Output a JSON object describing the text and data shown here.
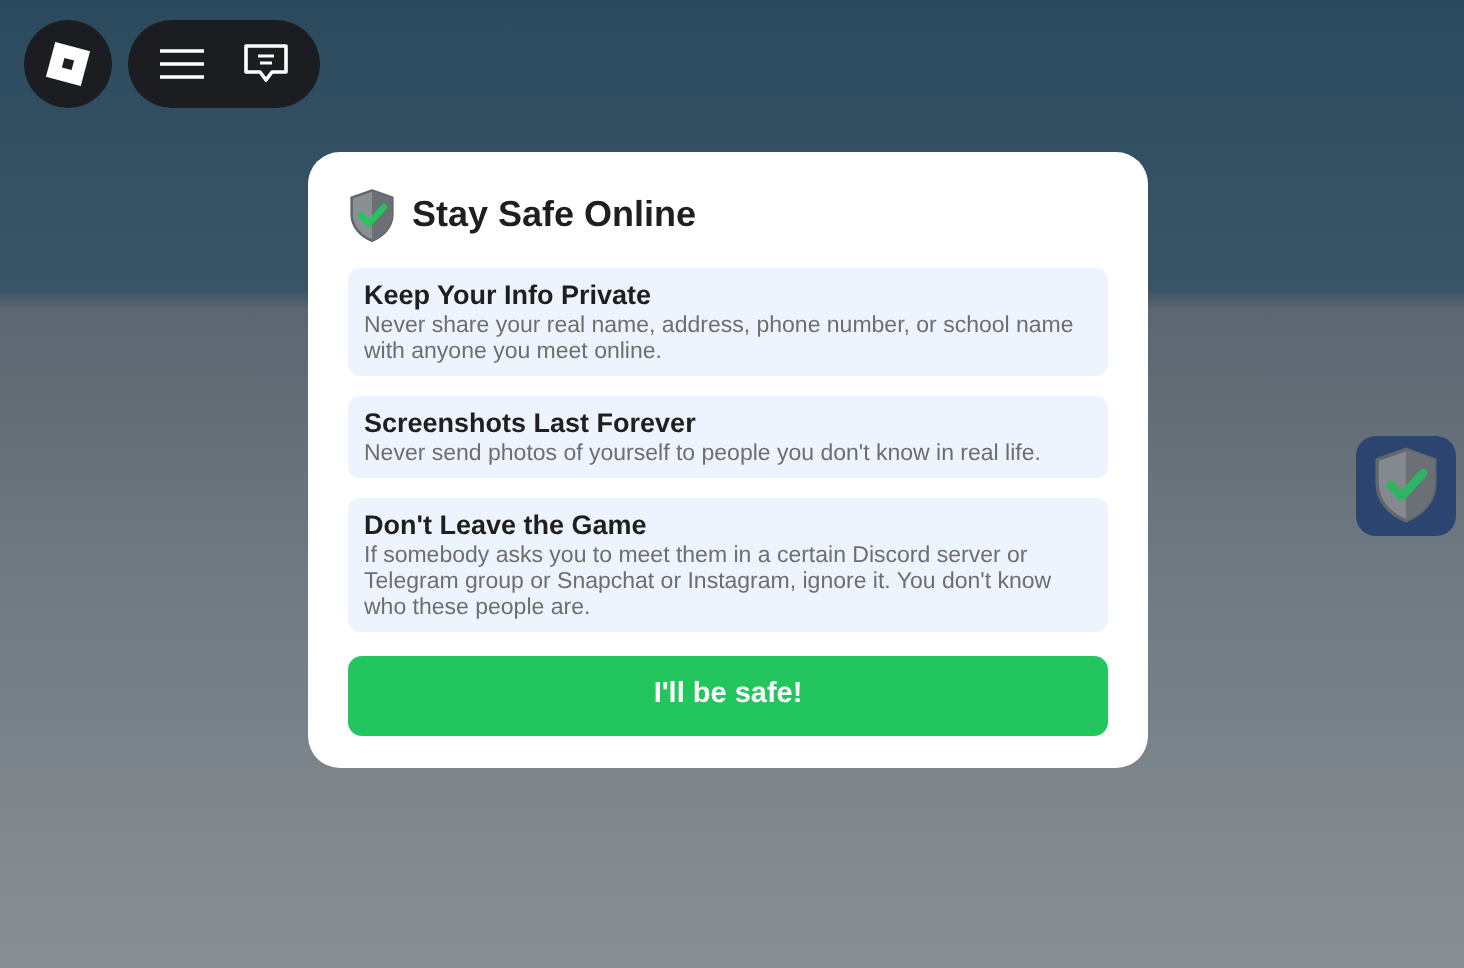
{
  "modal": {
    "title": "Stay Safe Online",
    "tips": [
      {
        "heading": "Keep Your Info Private",
        "body": "Never share your real name, address, phone number, or school name with anyone you meet online."
      },
      {
        "heading": "Screenshots Last Forever",
        "body": "Never send photos of yourself to people you don't know in real life."
      },
      {
        "heading": "Don't Leave the Game",
        "body": "If somebody asks you to meet them in a certain Discord server or Telegram group or Snapchat or Instagram, ignore it. You don't know who these people are."
      }
    ],
    "button": "I'll be safe!"
  }
}
